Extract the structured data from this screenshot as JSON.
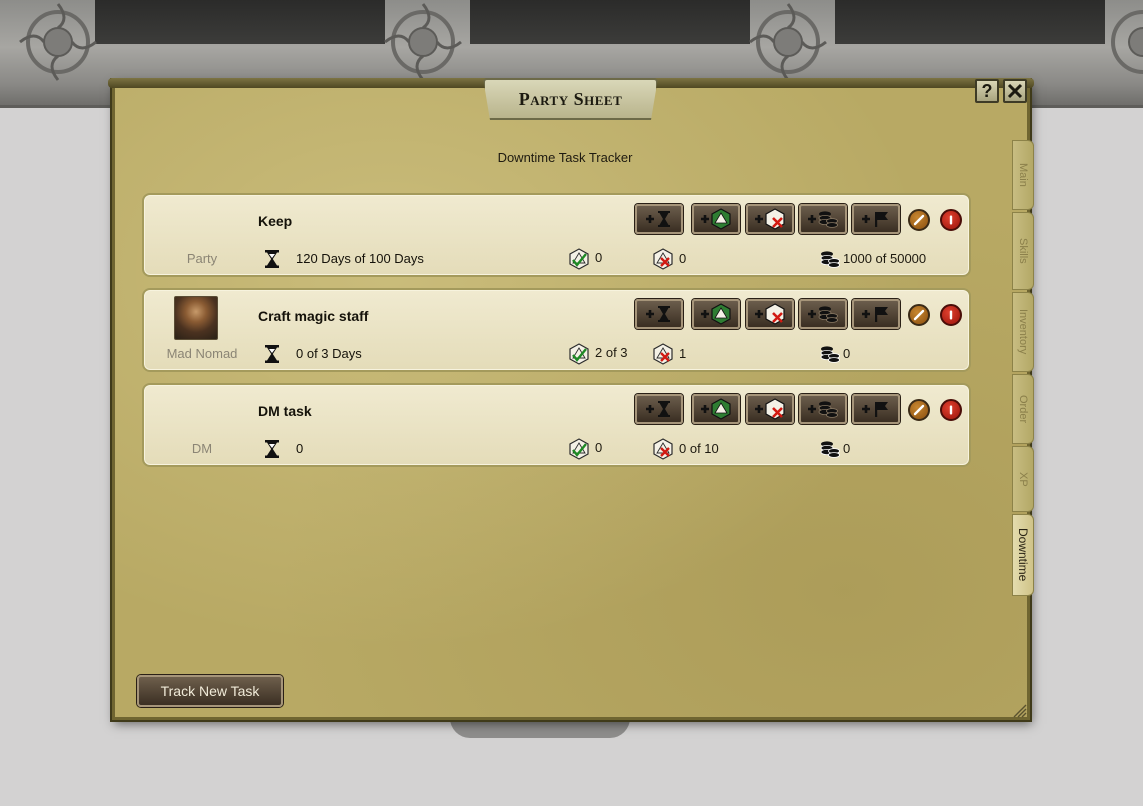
{
  "window": {
    "title": "Party Sheet",
    "help_label": "?",
    "close_label": "✕",
    "subtitle": "Downtime Task Tracker"
  },
  "side_tabs": [
    {
      "label": "Main",
      "active": false
    },
    {
      "label": "Skills",
      "active": false
    },
    {
      "label": "Inventory",
      "active": false
    },
    {
      "label": "Order",
      "active": false
    },
    {
      "label": "XP",
      "active": false
    },
    {
      "label": "Downtime",
      "active": true
    }
  ],
  "tasks": [
    {
      "name": "Keep",
      "owner": "Party",
      "has_portrait": false,
      "time": "120 Days of 100 Days",
      "successes": "0",
      "failures": "0",
      "cost": "1000 of 50000"
    },
    {
      "name": "Craft magic staff",
      "owner": "Mad Nomad",
      "has_portrait": true,
      "time": "0 of 3 Days",
      "successes": "2 of 3",
      "failures": "1",
      "cost": "0"
    },
    {
      "name": "DM task",
      "owner": "DM",
      "has_portrait": false,
      "time": "0",
      "successes": "0",
      "failures": "0 of 10",
      "cost": "0"
    }
  ],
  "actions": {
    "add_time_icon": "add-hourglass-icon",
    "add_success_icon": "add-success-die-icon",
    "add_failure_icon": "add-failure-die-icon",
    "add_cost_icon": "add-coins-icon",
    "add_flag_icon": "add-flag-icon",
    "edit_icon": "pencil-icon",
    "delete_icon": "delete-icon"
  },
  "footer": {
    "track_button": "Track New Task"
  },
  "colors": {
    "parchment": "#b8a964",
    "row_bg": "#f0ead0",
    "button_dark": "#3a2e22",
    "edit_orange": "#c7862f",
    "delete_red": "#c72a1c"
  }
}
